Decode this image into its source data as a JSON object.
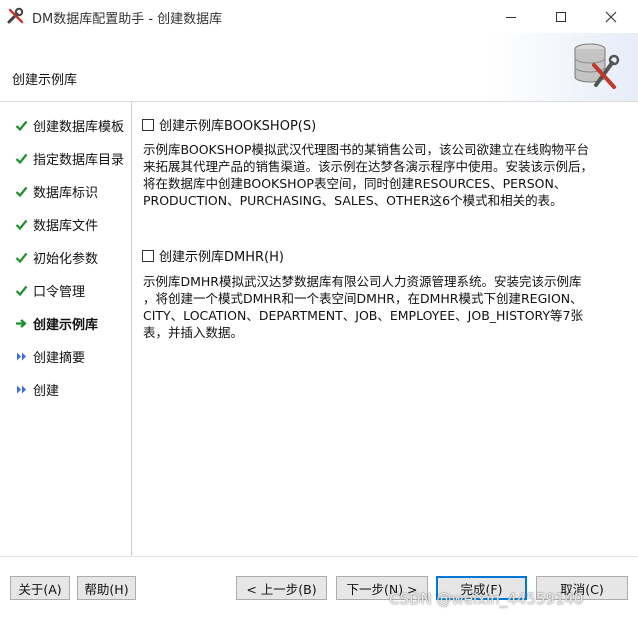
{
  "window": {
    "title": "DM数据库配置助手 - 创建数据库",
    "app_icon": "tools-icon"
  },
  "header": {
    "heading": "创建示例库",
    "icon": "database-tools-icon"
  },
  "sidebar": {
    "steps": [
      {
        "label": "创建数据库模板",
        "status": "done",
        "icon": "check-icon"
      },
      {
        "label": "指定数据库目录",
        "status": "done",
        "icon": "check-icon"
      },
      {
        "label": "数据库标识",
        "status": "done",
        "icon": "check-icon"
      },
      {
        "label": "数据库文件",
        "status": "done",
        "icon": "check-icon"
      },
      {
        "label": "初始化参数",
        "status": "done",
        "icon": "check-icon"
      },
      {
        "label": "口令管理",
        "status": "done",
        "icon": "check-icon"
      },
      {
        "label": "创建示例库",
        "status": "current",
        "icon": "arrow-right-icon"
      },
      {
        "label": "创建摘要",
        "status": "pending",
        "icon": "double-chevron-icon"
      },
      {
        "label": "创建",
        "status": "pending",
        "icon": "double-chevron-icon"
      }
    ]
  },
  "options": [
    {
      "label": "创建示例库BOOKSHOP(S)",
      "checked": false,
      "description": [
        "示例库BOOKSHOP模拟武汉代理图书的某销售公司，该公司欲建立在线购物平台",
        "来拓展其代理产品的销售渠道。该示例在达梦各演示程序中使用。安装该示例后，",
        "将在数据库中创建BOOKSHOP表空间，同时创建RESOURCES、PERSON、",
        "PRODUCTION、PURCHASING、SALES、OTHER这6个模式和相关的表。"
      ]
    },
    {
      "label": "创建示例库DMHR(H)",
      "checked": false,
      "description": [
        "示例库DMHR模拟武汉达梦数据库有限公司人力资源管理系统。安装完该示例库",
        "，将创建一个模式DMHR和一个表空间DMHR，在DMHR模式下创建REGION、",
        "CITY、LOCATION、DEPARTMENT、JOB、EMPLOYEE、JOB_HISTORY等7张",
        "表，并插入数据。"
      ]
    }
  ],
  "footer": {
    "about": "关于(A)",
    "help": "帮助(H)",
    "prev": "< 上一步(B)",
    "next": "下一步(N) >",
    "finish": "完成(F)",
    "cancel": "取消(C)"
  },
  "watermark": "CSDN @weixin_44559140",
  "colors": {
    "check": "#1a8f2a",
    "arrow": "#1a8f2a",
    "chevron": "#3a6fd8",
    "focus_border": "#0078d7"
  }
}
